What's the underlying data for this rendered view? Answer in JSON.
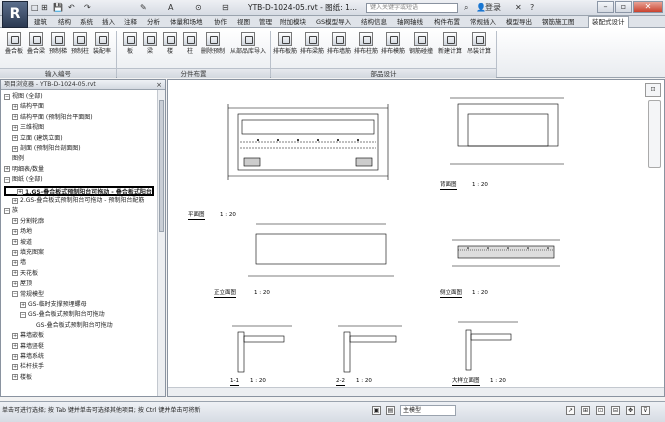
{
  "app": {
    "logo": "R",
    "doc_title": "YTB-D-1024-05.rvt - 图纸: 1...",
    "search_placeholder": "键入关键字或短语",
    "login": "登录",
    "help": "?"
  },
  "quick_access": [
    "□",
    "⊞",
    "💾",
    "↶",
    "↷",
    "✎",
    "A",
    "⊙",
    "⊟"
  ],
  "ribbon_tabs": [
    "建筑",
    "结构",
    "系统",
    "插入",
    "注释",
    "分析",
    "体量和场地",
    "协作",
    "视图",
    "管理",
    "附加模块",
    "GS模型导入",
    "结构信息",
    "轴网轴线",
    "构件布置",
    "常规插入",
    "模型导出",
    "钢筋施工图",
    "装配式设计"
  ],
  "active_tab_index": 18,
  "ribbon_buttons": [
    {
      "label": "叠合板"
    },
    {
      "label": "叠合梁"
    },
    {
      "label": "预制梯"
    },
    {
      "label": "预制柱"
    },
    {
      "label": "装配率"
    },
    {
      "label": "板"
    },
    {
      "label": "梁"
    },
    {
      "label": "楼"
    },
    {
      "label": "柱"
    },
    {
      "label": "删除预制"
    },
    {
      "label": "从部品库导入"
    },
    {
      "label": "排布板筋"
    },
    {
      "label": "排布梁筋"
    },
    {
      "label": "排布墙筋"
    },
    {
      "label": "排布柱筋"
    },
    {
      "label": "排布模筋"
    },
    {
      "label": "钢筋碰撞"
    },
    {
      "label": "新建计算"
    },
    {
      "label": "吊装计算"
    }
  ],
  "ribbon_groups": [
    "输入编号",
    "分件布置",
    "部品设计"
  ],
  "browser": {
    "title": "项目浏览器 - YTB-D-1024-05.rvt",
    "close": "×",
    "rows": [
      {
        "text": "视图 (全部)",
        "toggle": "−",
        "indent": 0
      },
      {
        "text": "结构平面",
        "toggle": "+",
        "indent": 1
      },
      {
        "text": "结构平面 (预制阳台平面图)",
        "toggle": "+",
        "indent": 1
      },
      {
        "text": "三维视图",
        "toggle": "+",
        "indent": 1
      },
      {
        "text": "立面 (建筑立面)",
        "toggle": "+",
        "indent": 1
      },
      {
        "text": "剖面 (预制阳台剖面图)",
        "toggle": "+",
        "indent": 1
      },
      {
        "text": "图例",
        "toggle": "",
        "indent": 0
      },
      {
        "text": "明细表/数量",
        "toggle": "+",
        "indent": 0
      },
      {
        "text": "图纸 (全部)",
        "toggle": "−",
        "indent": 0
      },
      {
        "text": "1.GS-叠合板式预制阳台可拖动 - 叠合板式阳台",
        "toggle": "+",
        "indent": 1,
        "highlight": true
      },
      {
        "text": "2.GS-叠合板式预制阳台可拖动 - 预制阳台配筋",
        "toggle": "+",
        "indent": 1
      },
      {
        "text": "族",
        "toggle": "−",
        "indent": 0
      },
      {
        "text": "分割轮廓",
        "toggle": "+",
        "indent": 1
      },
      {
        "text": "场地",
        "toggle": "+",
        "indent": 1
      },
      {
        "text": "坡道",
        "toggle": "+",
        "indent": 1
      },
      {
        "text": "填充图案",
        "toggle": "+",
        "indent": 1
      },
      {
        "text": "墙",
        "toggle": "+",
        "indent": 1
      },
      {
        "text": "天花板",
        "toggle": "+",
        "indent": 1
      },
      {
        "text": "屋顶",
        "toggle": "+",
        "indent": 1
      },
      {
        "text": "常规模型",
        "toggle": "−",
        "indent": 1
      },
      {
        "text": "GS-临时支撑预埋螺母",
        "toggle": "+",
        "indent": 2
      },
      {
        "text": "GS-叠合板式预制阳台可拖动",
        "toggle": "−",
        "indent": 2
      },
      {
        "text": "GS-叠合板式预制阳台可拖动",
        "toggle": "",
        "indent": 3
      },
      {
        "text": "幕墙嵌板",
        "toggle": "+",
        "indent": 1
      },
      {
        "text": "幕墙竖梃",
        "toggle": "+",
        "indent": 1
      },
      {
        "text": "幕墙系统",
        "toggle": "+",
        "indent": 1
      },
      {
        "text": "栏杆扶手",
        "toggle": "+",
        "indent": 1
      },
      {
        "text": "楼板",
        "toggle": "+",
        "indent": 1
      }
    ]
  },
  "drawing_labels": {
    "plan": "平面图",
    "plan_scale": "1 : 20",
    "back_elev": "背面图",
    "back_scale": "1 : 20",
    "front_elev": "正立面图",
    "front_scale": "1 : 20",
    "side_elev": "侧立面图",
    "side_scale": "1 : 20",
    "sec1": "1-1",
    "sec2": "2-2",
    "sec3": "大样立面图",
    "scale_20": "1 : 20"
  },
  "status": {
    "text": "单击可进行选择; 按 Tab 键并单击可选择其他项目; 按 Ctrl 键并单击可将新",
    "model": "主模型",
    "view_scale": "1 : 20"
  }
}
